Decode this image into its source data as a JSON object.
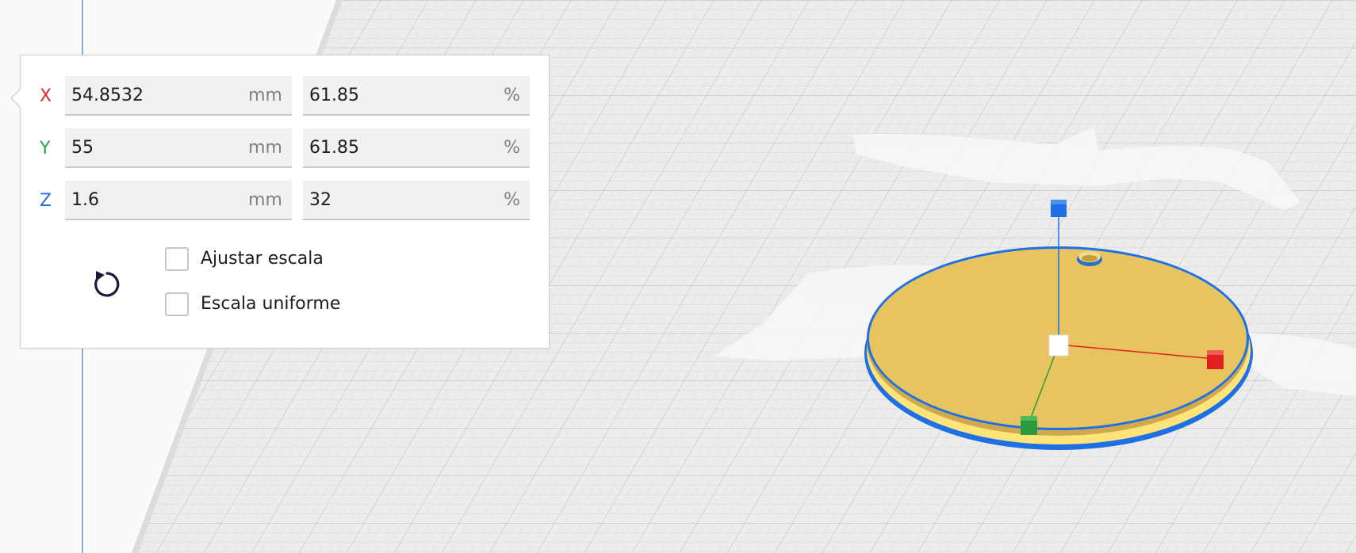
{
  "scale_panel": {
    "rows": [
      {
        "axis": "X",
        "color": "#d4302c",
        "mm_value": "54.8532",
        "mm_unit": "mm",
        "pct_value": "61.85",
        "pct_unit": "%"
      },
      {
        "axis": "Y",
        "color": "#30a24a",
        "mm_value": "55",
        "mm_unit": "mm",
        "pct_value": "61.85",
        "pct_unit": "%"
      },
      {
        "axis": "Z",
        "color": "#2a6fdc",
        "mm_value": "1.6",
        "mm_unit": "mm",
        "pct_value": "32",
        "pct_unit": "%"
      }
    ],
    "snap_scaling": {
      "label": "Ajustar escala",
      "checked": false
    },
    "uniform_scaling": {
      "label": "Escala uniforme",
      "checked": false
    },
    "reset_icon": "reset-icon"
  },
  "viewport": {
    "model_color": "#e8c460",
    "selection_outline_color": "#1f6fe5",
    "handle_colors": {
      "x": "#e0201e",
      "y": "#2a9a3c",
      "z": "#1f6fe5",
      "center": "#ffffff"
    }
  }
}
